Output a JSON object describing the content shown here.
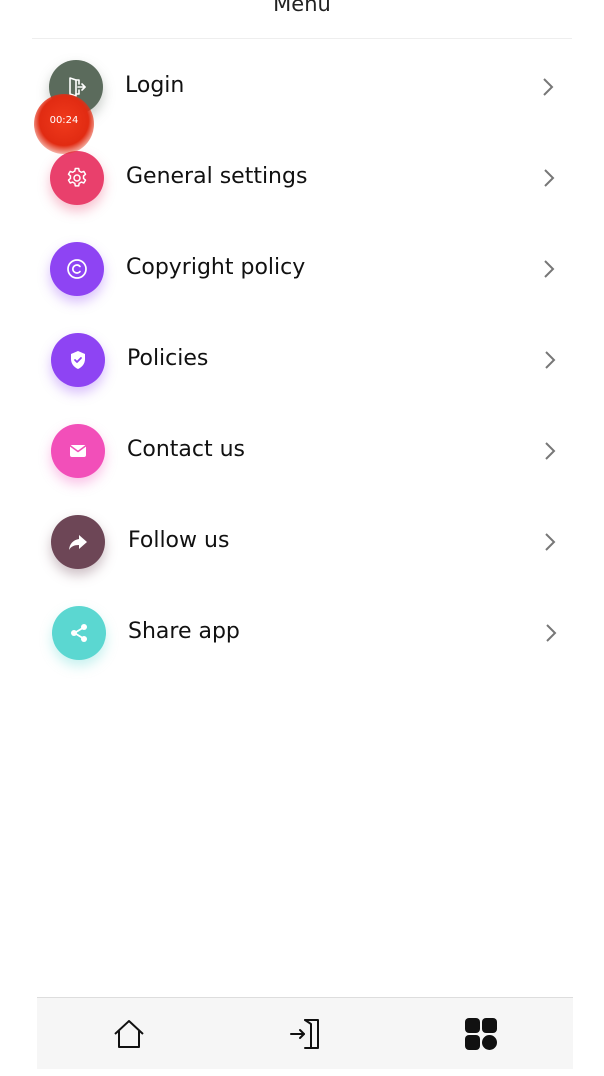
{
  "header": {
    "title": "Menu"
  },
  "timer": {
    "text": "00:24"
  },
  "menu": [
    {
      "label": "Login",
      "icon": "login-door-icon",
      "color": "#5b6b5c"
    },
    {
      "label": "General settings",
      "icon": "gear-icon",
      "color": "#e9406c"
    },
    {
      "label": "Copyright policy",
      "icon": "copyright-icon",
      "color": "#8e44f3"
    },
    {
      "label": "Policies",
      "icon": "shield-check-icon",
      "color": "#8e44f3"
    },
    {
      "label": "Contact us",
      "icon": "envelope-icon",
      "color": "#f24fb9"
    },
    {
      "label": "Follow us",
      "icon": "share-arrow-icon",
      "color": "#6d4656"
    },
    {
      "label": "Share app",
      "icon": "share-nodes-icon",
      "color": "#5bd7d1"
    }
  ],
  "bottom_nav": [
    {
      "icon": "home-icon"
    },
    {
      "icon": "login-icon"
    },
    {
      "icon": "grid-menu-icon"
    }
  ]
}
